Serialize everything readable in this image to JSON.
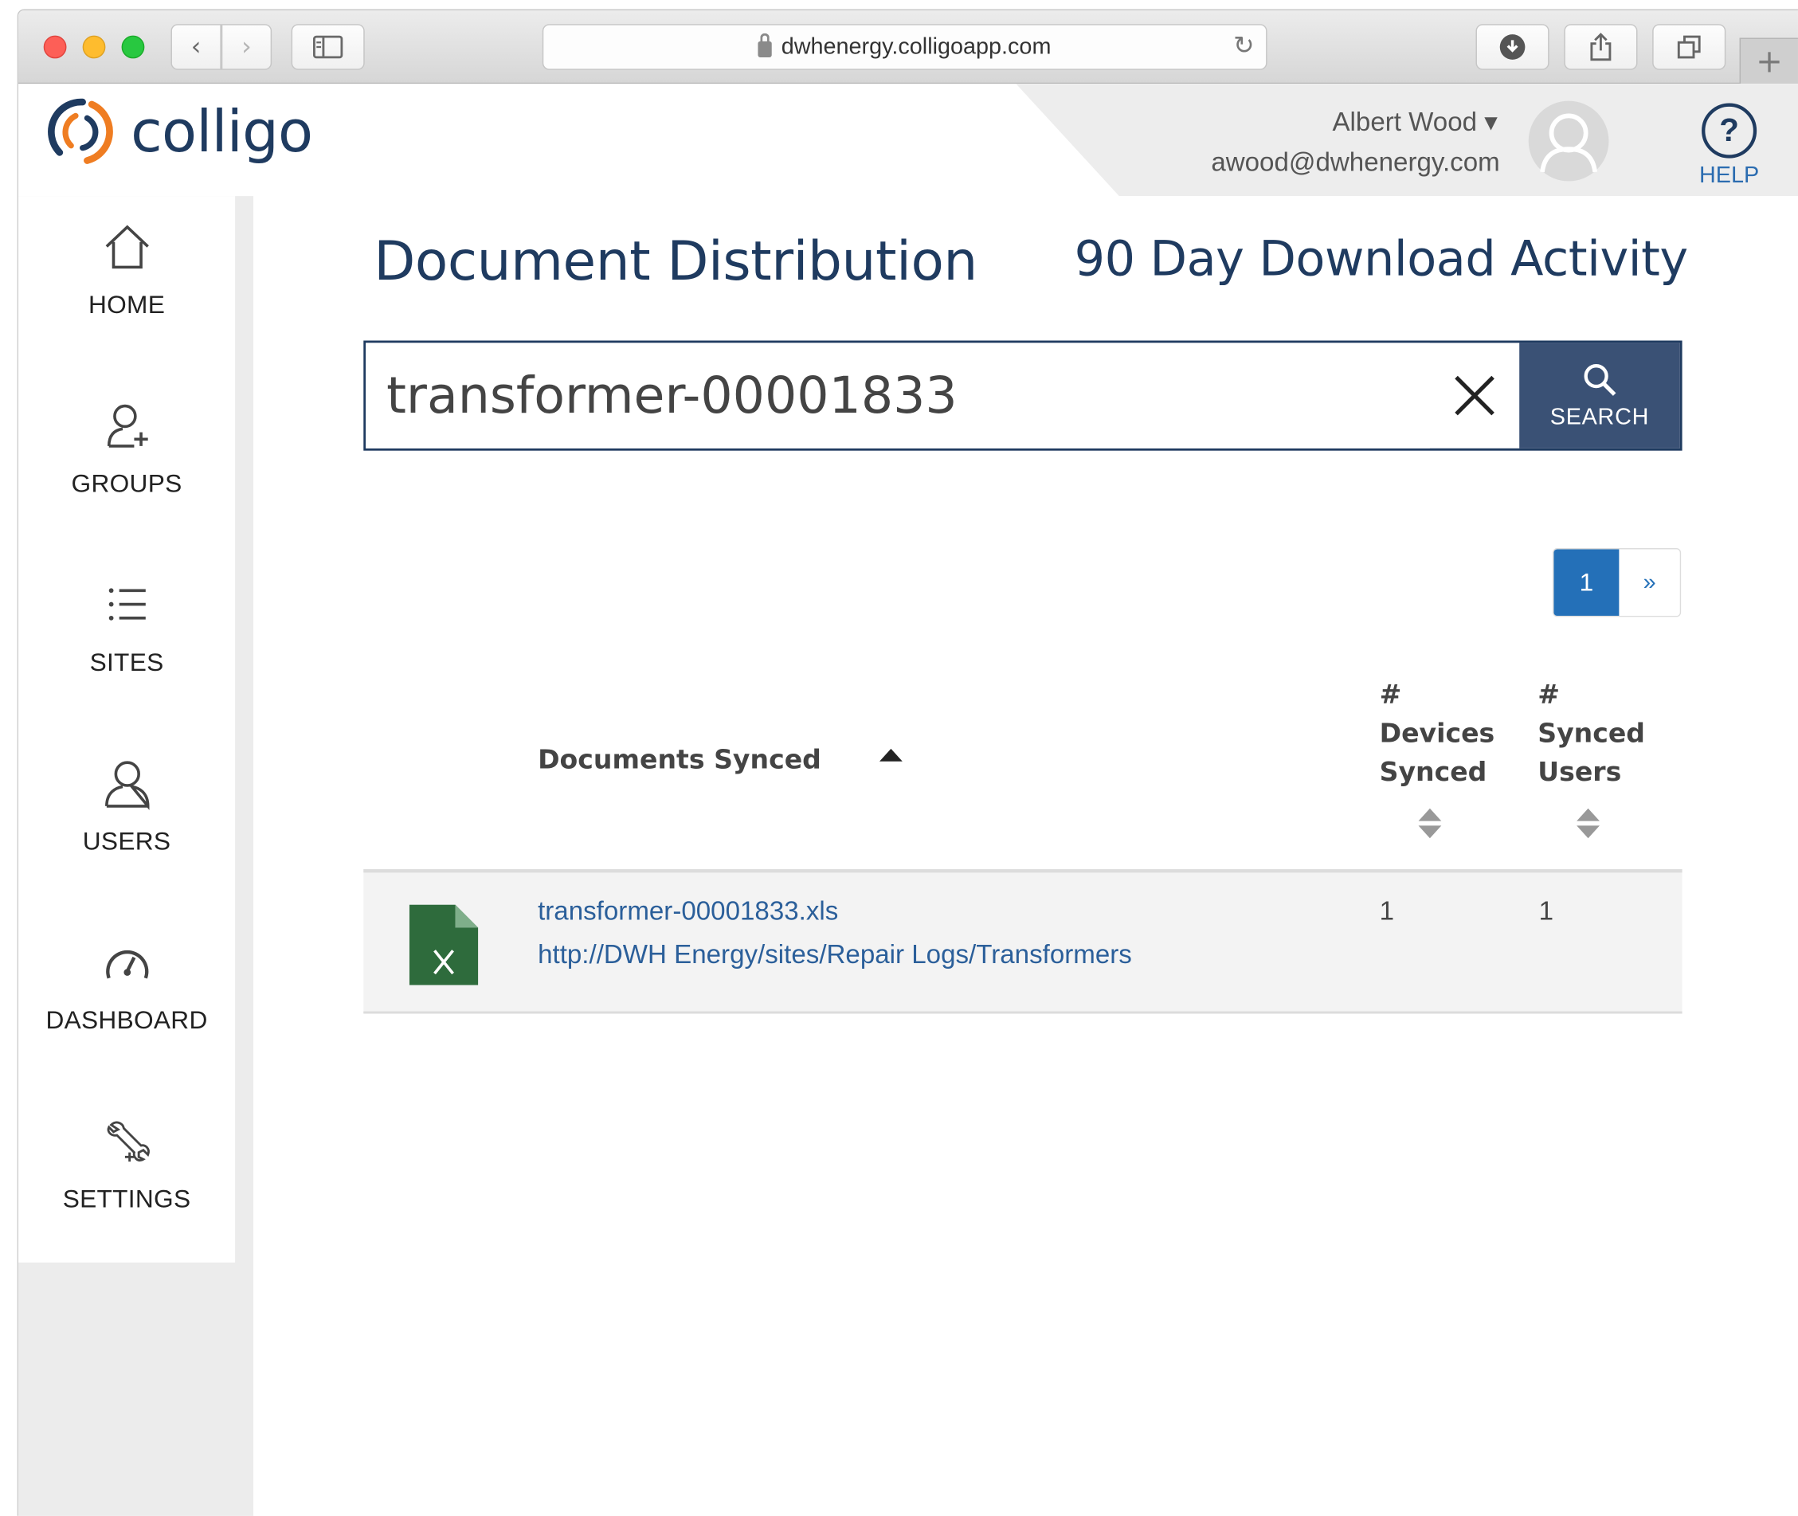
{
  "browser": {
    "url": "dwhenergy.colligoapp.com"
  },
  "header": {
    "brand": "colligo",
    "user_name": "Albert Wood ▾",
    "user_email": "awood@dwhenergy.com",
    "help_label": "HELP"
  },
  "sidebar": {
    "items": [
      {
        "label": "HOME",
        "icon": "home-icon"
      },
      {
        "label": "GROUPS",
        "icon": "add-user-icon"
      },
      {
        "label": "SITES",
        "icon": "list-icon"
      },
      {
        "label": "USERS",
        "icon": "user-icon"
      },
      {
        "label": "DASHBOARD",
        "icon": "gauge-icon"
      },
      {
        "label": "SETTINGS",
        "icon": "tools-icon"
      }
    ]
  },
  "main": {
    "title": "Document Distribution",
    "secondary_title": "90 Day Download Activity",
    "search": {
      "value": "transformer-00001833",
      "button_label": "SEARCH"
    },
    "pagination": {
      "current": "1",
      "next": "»"
    },
    "table": {
      "columns": {
        "documents": "Documents Synced",
        "devices": [
          "#",
          "Devices",
          "Synced"
        ],
        "users": [
          "#",
          "Synced",
          "Users"
        ]
      },
      "rows": [
        {
          "name": "transformer-00001833.xls",
          "path": "http://DWH Energy/sites/Repair Logs/Transformers",
          "devices_synced": "1",
          "synced_users": "1"
        }
      ]
    }
  },
  "colors": {
    "brand_navy": "#1f3b60",
    "accent_blue": "#2470b8",
    "search_button": "#3a5175",
    "excel_green": "#2e6b3c",
    "logo_orange": "#ef7d22"
  }
}
